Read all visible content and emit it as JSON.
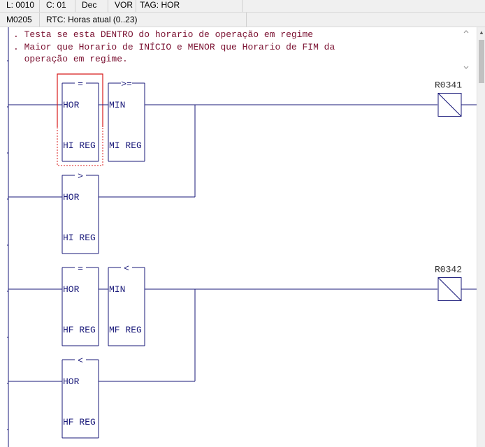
{
  "status": {
    "line": "L: 0010",
    "column": "C: 01",
    "format": "Dec",
    "mode": "VOR",
    "tag": "TAG: HOR"
  },
  "info": {
    "address": "M0205",
    "description": "RTC: Horas atual (0..23)"
  },
  "comment": {
    "lines": [
      ". Testa se esta DENTRO do horario de operação em regime",
      ". Maior que Horario de INÍCIO e MENOR que Horario de FIM da",
      "  operação em regime."
    ]
  },
  "rungs": [
    {
      "coil": "R0341",
      "rows": [
        {
          "blocks": [
            {
              "op": "=",
              "a": "HOR",
              "b": "HI REG",
              "selected": true
            },
            {
              "op": ">=",
              "a": "MIN",
              "b": "MI REG",
              "selected": false
            }
          ]
        },
        {
          "blocks": [
            {
              "op": ">",
              "a": "HOR",
              "b": "HI REG",
              "selected": false
            }
          ]
        }
      ]
    },
    {
      "coil": "R0342",
      "rows": [
        {
          "blocks": [
            {
              "op": "=",
              "a": "HOR",
              "b": "HF REG",
              "selected": false
            },
            {
              "op": "<",
              "a": "MIN",
              "b": "MF REG",
              "selected": false
            }
          ]
        },
        {
          "blocks": [
            {
              "op": "<",
              "a": "HOR",
              "b": "HF REG",
              "selected": false
            }
          ]
        }
      ]
    }
  ],
  "colors": {
    "ladder": "#1a1a7a",
    "comment": "#7a1030",
    "selection": "#d81b1b"
  }
}
